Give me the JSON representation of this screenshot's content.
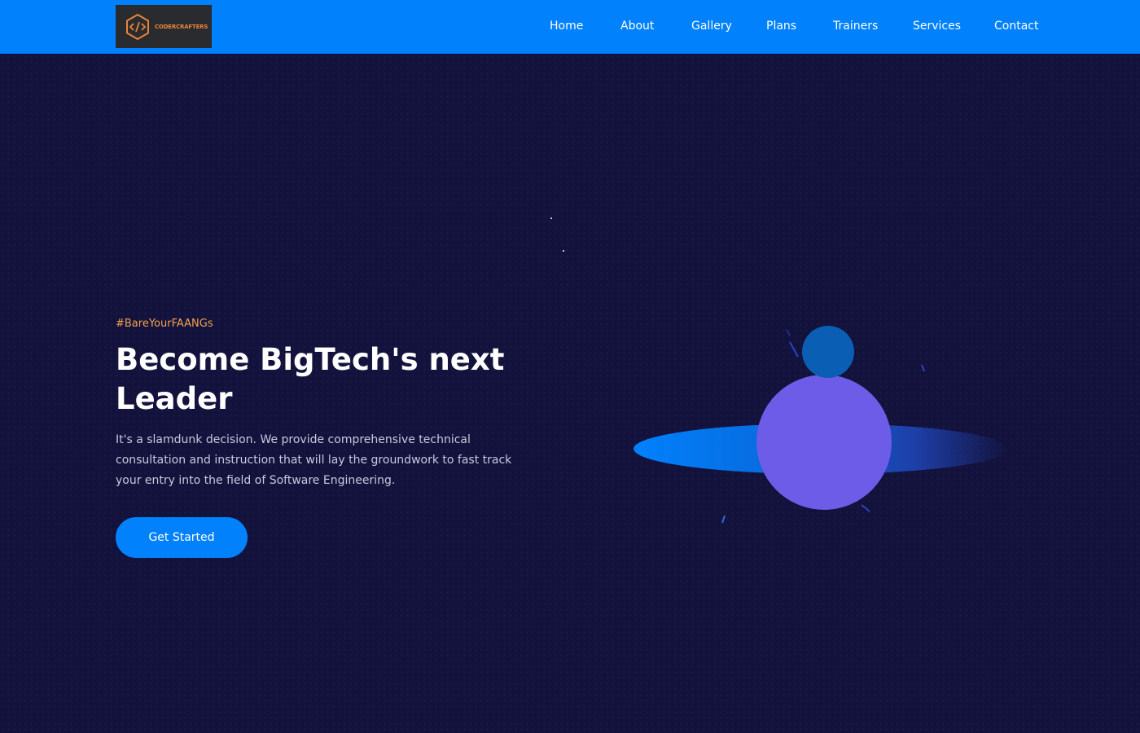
{
  "brand": {
    "logo_text": "CODERCRAFTERS",
    "logo_icon": "code-hexagon-icon",
    "accent_color": "#e8843a"
  },
  "nav": {
    "items": [
      {
        "label": "Home"
      },
      {
        "label": "About"
      },
      {
        "label": "Gallery"
      },
      {
        "label": "Plans"
      },
      {
        "label": "Trainers"
      },
      {
        "label": "Services"
      },
      {
        "label": "Contact"
      }
    ]
  },
  "hero": {
    "tagline": "#BareYourFAANGs",
    "headline": "Become BigTech's next Leader",
    "description": "It's a slamdunk decision. We provide comprehensive technical consultation and instruction that will lay the groundwork to fast track your entry into the field of Software Engineering.",
    "cta_label": "Get Started"
  },
  "colors": {
    "nav_background": "#0181fc",
    "page_background": "#12123c",
    "tagline": "#f5a24a",
    "button": "#0181fc",
    "planet": "#6c5ce7",
    "moon": "#0a5fb4"
  }
}
